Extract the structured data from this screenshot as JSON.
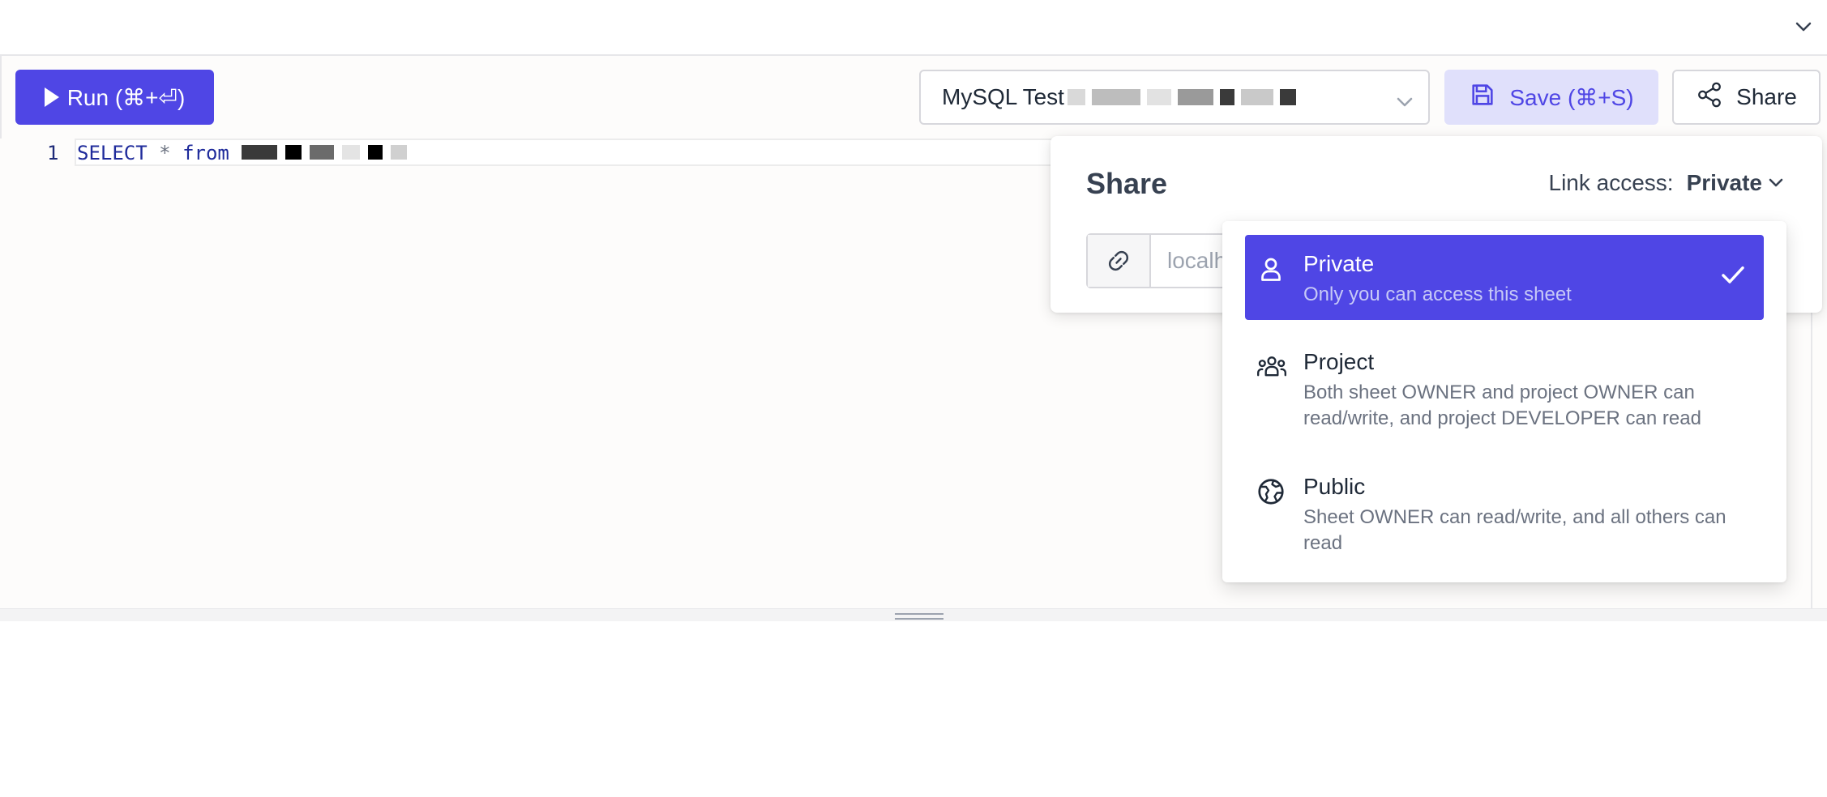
{
  "toolbar": {
    "run_label": "Run (⌘+⏎)",
    "database_select_value": "MySQL Test",
    "save_label": "Save (⌘+S)",
    "share_label": "Share"
  },
  "editor": {
    "line_number": "1",
    "code_keyword_select": "SELECT",
    "code_operator": "*",
    "code_keyword_from": "from"
  },
  "share_panel": {
    "title": "Share",
    "link_access_label": "Link access:",
    "link_access_value": "Private",
    "link_url_partial": "localh"
  },
  "access_options": [
    {
      "title": "Private",
      "description": "Only you can access this sheet",
      "icon": "user-icon",
      "selected": true
    },
    {
      "title": "Project",
      "description": "Both sheet OWNER and project OWNER can read/write, and project DEVELOPER can read",
      "icon": "users-group-icon",
      "selected": false
    },
    {
      "title": "Public",
      "description": "Sheet OWNER can read/write, and all others can read",
      "icon": "globe-icon",
      "selected": false
    }
  ],
  "colors": {
    "accent": "#4f46e5",
    "accent_light": "#e0e0fb",
    "border": "#d7d7dc",
    "muted_text": "#6b7280"
  }
}
